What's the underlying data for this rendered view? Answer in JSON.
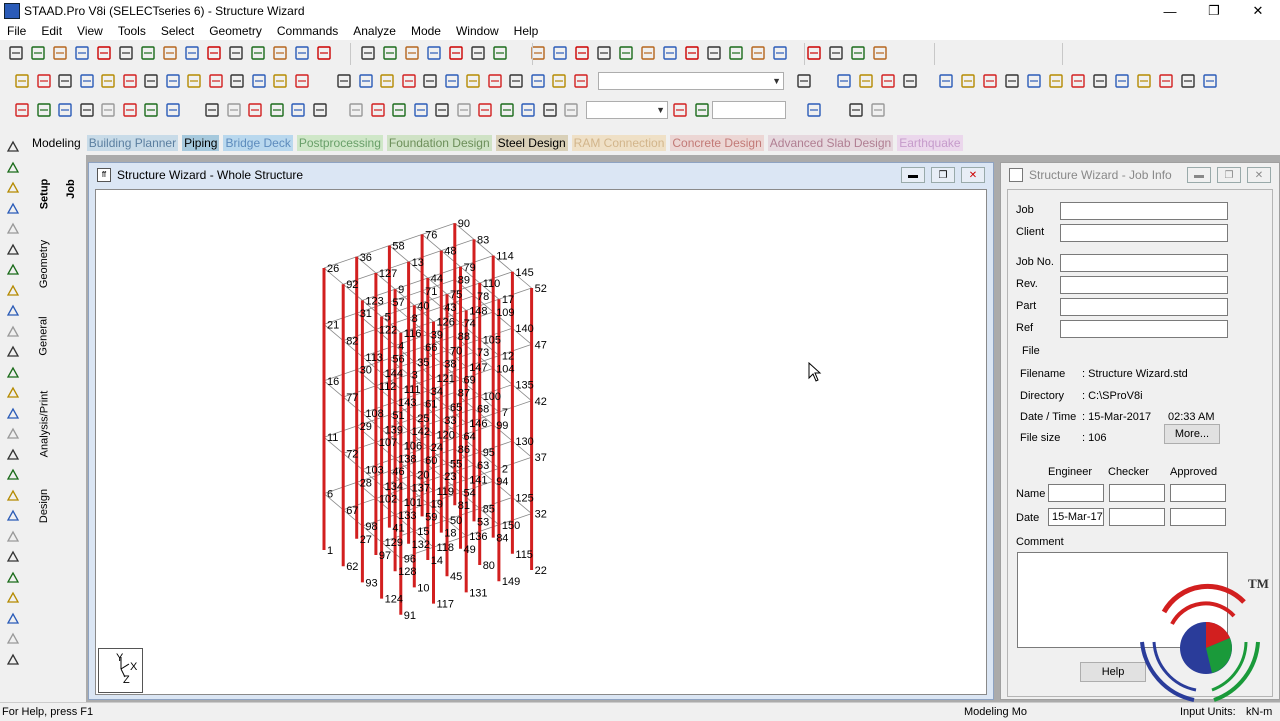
{
  "titlebar": {
    "title": "STAAD.Pro V8i (SELECTseries 6) - Structure Wizard",
    "min": "—",
    "max": "❐",
    "close": "✕"
  },
  "menu": [
    "File",
    "Edit",
    "View",
    "Tools",
    "Select",
    "Geometry",
    "Commands",
    "Analyze",
    "Mode",
    "Window",
    "Help"
  ],
  "modes": [
    {
      "label": "Modeling",
      "bg": "#f0f0f0",
      "fg": "#000000"
    },
    {
      "label": "Building Planner",
      "bg": "#c8dbe8",
      "fg": "#5b7fa0"
    },
    {
      "label": "Piping",
      "bg": "#a6c9dd",
      "fg": "#000000"
    },
    {
      "label": "Bridge Deck",
      "bg": "#b9d8ee",
      "fg": "#5d8bbd"
    },
    {
      "label": "Postprocessing",
      "bg": "#cfe7c8",
      "fg": "#6aa06a"
    },
    {
      "label": "Foundation Design",
      "bg": "#cfe2c5",
      "fg": "#6d8f5a"
    },
    {
      "label": "Steel Design",
      "bg": "#d9d0b8",
      "fg": "#000000"
    },
    {
      "label": "RAM Connection",
      "bg": "#efe0c6",
      "fg": "#d2b58b"
    },
    {
      "label": "Concrete Design",
      "bg": "#ecd6d4",
      "fg": "#c27a77"
    },
    {
      "label": "Advanced Slab Design",
      "bg": "#e6d8de",
      "fg": "#b07e92"
    },
    {
      "label": "Earthquake",
      "bg": "#ebd7ec",
      "fg": "#c69bcb"
    }
  ],
  "sidetabs": {
    "setup": "Setup",
    "geometry": "Geometry",
    "general": "General",
    "analysis": "Analysis/Print",
    "design": "Design",
    "job": "Job"
  },
  "structure_window": {
    "title": "Structure Wizard - Whole Structure"
  },
  "axes": {
    "y": "Y",
    "x": "X",
    "z": "Z"
  },
  "node_labels": [
    "1",
    "6",
    "11",
    "16",
    "21",
    "26",
    "27",
    "28",
    "29",
    "30",
    "31",
    "36",
    "41",
    "46",
    "51",
    "56",
    "57",
    "58",
    "59",
    "60",
    "61",
    "66",
    "71",
    "76",
    "81",
    "86",
    "87",
    "88",
    "89",
    "90",
    "91",
    "96",
    "101",
    "106",
    "111",
    "116",
    "117",
    "118",
    "119",
    "120",
    "121",
    "126",
    "131",
    "136",
    "141",
    "146",
    "147",
    "148",
    "149",
    "150",
    "2",
    "7",
    "12",
    "17",
    "22",
    "32",
    "37",
    "42",
    "47",
    "52",
    "62",
    "67",
    "72",
    "77",
    "82",
    "92",
    "97",
    "102",
    "107",
    "112",
    "122",
    "127",
    "132",
    "137",
    "142",
    "3",
    "8",
    "13",
    "18",
    "23",
    "33",
    "38",
    "43",
    "48",
    "53",
    "63",
    "68",
    "73",
    "78",
    "83",
    "93",
    "98",
    "103",
    "108",
    "113",
    "123",
    "128",
    "133",
    "138",
    "143",
    "4",
    "9",
    "14",
    "19",
    "24",
    "34",
    "39",
    "44",
    "49",
    "54",
    "64",
    "69",
    "74",
    "79",
    "84",
    "94",
    "99",
    "104",
    "109",
    "114",
    "124",
    "129",
    "134",
    "139",
    "144",
    "5",
    "10",
    "15",
    "20",
    "25",
    "35",
    "40",
    "45",
    "50",
    "55",
    "65",
    "70",
    "75",
    "80",
    "85",
    "95",
    "100",
    "105",
    "110",
    "115",
    "125",
    "130",
    "135",
    "140",
    "145"
  ],
  "job_info": {
    "title": "Structure Wizard - Job Info",
    "job_label": "Job",
    "client_label": "Client",
    "jobno_label": "Job No.",
    "rev_label": "Rev.",
    "part_label": "Part",
    "ref_label": "Ref",
    "job": "",
    "client": "",
    "jobno": "",
    "rev": "",
    "part": "",
    "ref": "",
    "file_group": "File",
    "filename_label": "Filename",
    "filename_value": ": Structure Wizard.std",
    "directory_label": "Directory",
    "directory_value": ": C:\\SProV8i",
    "datetime_label": "Date / Time",
    "datetime_value": ": 15-Mar-2017",
    "time_value": "02:33 AM",
    "filesize_label": "File size",
    "filesize_value": ": 106",
    "more_button": "More...",
    "engineer_header": "Engineer",
    "checker_header": "Checker",
    "approved_header": "Approved",
    "name_label": "Name",
    "date_label": "Date",
    "engineer_date": "15-Mar-17",
    "comment_label": "Comment",
    "help_button": "Help"
  },
  "logo": {
    "tm": "TM"
  },
  "status": {
    "help": "For Help, press F1",
    "mode": "Modeling Mo",
    "units_label": "Input Units:",
    "units_value": "kN-m"
  },
  "colors": {
    "member": "#d21f1f",
    "grid_line": "#888888",
    "accent_blue": "#2a5bb8"
  }
}
